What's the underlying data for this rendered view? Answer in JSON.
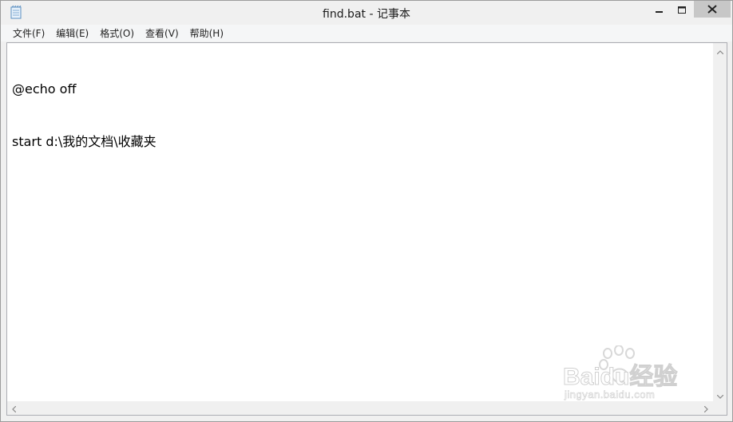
{
  "window": {
    "title": "find.bat - 记事本"
  },
  "menu": {
    "items": [
      {
        "label": "文件(F)"
      },
      {
        "label": "编辑(E)"
      },
      {
        "label": "格式(O)"
      },
      {
        "label": "查看(V)"
      },
      {
        "label": "帮助(H)"
      }
    ]
  },
  "editor": {
    "lines": [
      "@echo off",
      "start d:\\我的文档\\收藏夹"
    ]
  },
  "watermark": {
    "brand": "Baidu经验",
    "url": "jingyan.baidu.com"
  },
  "colors": {
    "titlebar": "#f0f0f0",
    "close_button": "#c7c7c7",
    "editor_bg": "#ffffff",
    "menubar": "#f5f6f7"
  }
}
